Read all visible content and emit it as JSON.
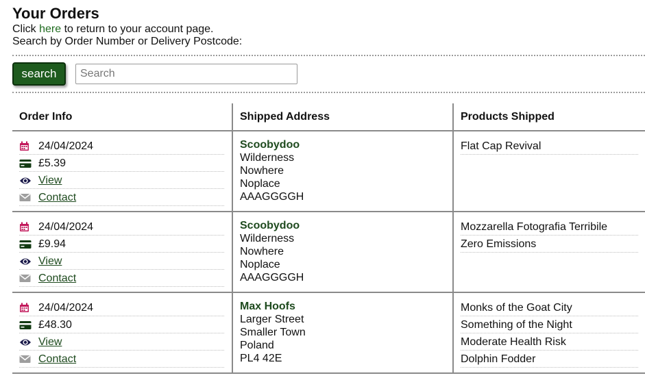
{
  "page": {
    "title": "Your Orders",
    "return_prefix": "Click ",
    "return_link": "here",
    "return_suffix": " to return to your account page.",
    "search_hint": "Search by Order Number or Delivery Postcode:"
  },
  "search": {
    "button_label": "search",
    "placeholder": "Search",
    "value": ""
  },
  "colors": {
    "accent_green": "#1e5b1e",
    "calendar_pink": "#c2185b",
    "card_dark": "#123a12",
    "eye_navy": "#1b1a4a",
    "mail_gray": "#9e9e9e"
  },
  "table": {
    "headers": [
      "Order Info",
      "Shipped Address",
      "Products Shipped"
    ],
    "orders": [
      {
        "date": "24/04/2024",
        "total": "£5.39",
        "view": "View",
        "contact": "Contact",
        "address": [
          "Scoobydoo",
          "Wilderness",
          "Nowhere",
          "Noplace",
          "AAAGGGGH"
        ],
        "products": [
          "Flat Cap Revival"
        ]
      },
      {
        "date": "24/04/2024",
        "total": "£9.94",
        "view": "View",
        "contact": "Contact",
        "address": [
          "Scoobydoo",
          "Wilderness",
          "Nowhere",
          "Noplace",
          "AAAGGGGH"
        ],
        "products": [
          "Mozzarella Fotografia Terribile",
          "Zero Emissions"
        ]
      },
      {
        "date": "24/04/2024",
        "total": "£48.30",
        "view": "View",
        "contact": "Contact",
        "address": [
          "Max Hoofs",
          "Larger Street",
          "Smaller Town",
          "Poland",
          "PL4 42E"
        ],
        "products": [
          "Monks of the Goat City",
          "Something of the Night",
          "Moderate Health Risk",
          "Dolphin Fodder"
        ]
      }
    ]
  }
}
